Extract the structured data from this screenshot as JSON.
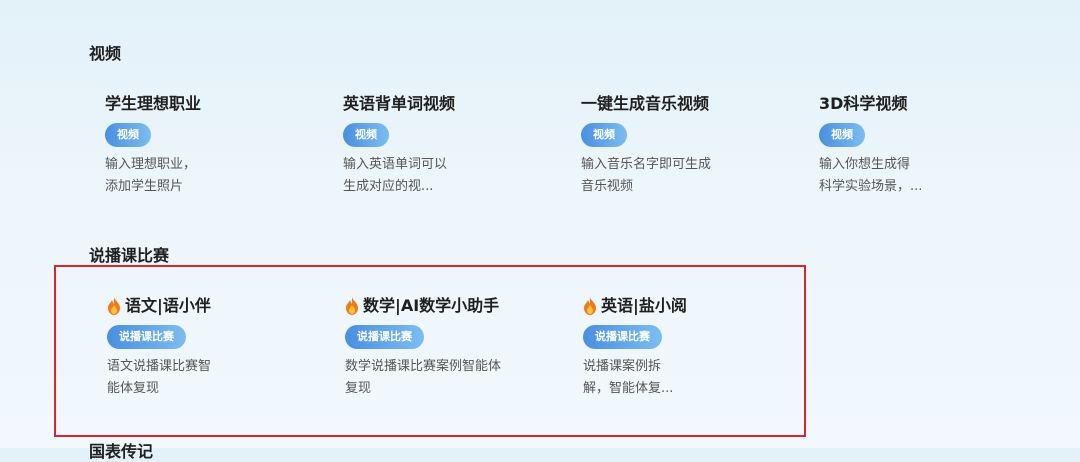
{
  "sections": [
    {
      "title": "视频",
      "cards": [
        {
          "title": "学生理想职业",
          "tag": "视频",
          "desc": "输入理想职业，\n添加学生照片"
        },
        {
          "title": "英语背单词视频",
          "tag": "视频",
          "desc": "输入英语单词可以\n生成对应的视..."
        },
        {
          "title": "一键生成音乐视频",
          "tag": "视频",
          "desc": "输入音乐名字即可生成\n音乐视频"
        },
        {
          "title": "3D科学视频",
          "tag": "视频",
          "desc": "输入你想生成得\n科学实验场景，..."
        }
      ]
    },
    {
      "title": "说播课比赛",
      "cards": [
        {
          "title": "语文|语小伴",
          "tag": "说播课比赛",
          "desc": "语文说播课比赛智\n能体复现",
          "icon": "flame-icon"
        },
        {
          "title": "数学|AI数学小助手",
          "tag": "说播课比赛",
          "desc": "数学说播课比赛案例智能体\n复现",
          "icon": "flame-icon"
        },
        {
          "title": "英语|盐小阅",
          "tag": "说播课比赛",
          "desc": "说播课案例拆\n解，智能体复...",
          "icon": "flame-icon"
        }
      ]
    },
    {
      "title": "国表传记"
    }
  ],
  "colors": {
    "highlight": "#d9262b",
    "tag_start": "#4a8fe0",
    "tag_end": "#7cbdf0"
  }
}
